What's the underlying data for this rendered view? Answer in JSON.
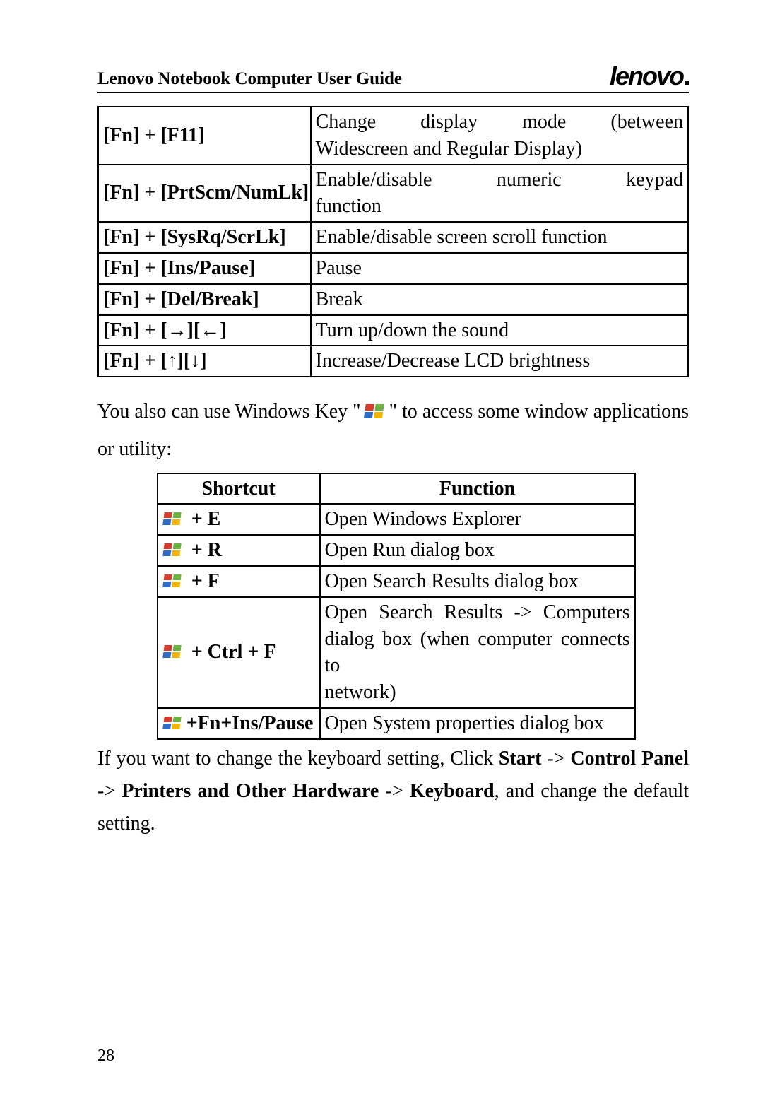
{
  "header": {
    "title": "Lenovo Notebook Computer User Guide",
    "logo": "lenovo"
  },
  "fn_table": {
    "rows": [
      {
        "key": "[Fn] + [F11]",
        "desc_line1": "Change display mode (between",
        "desc_line2": "Widescreen and Regular Display)",
        "justify": true
      },
      {
        "key": "[Fn] + [PrtScm/NumLk]",
        "desc_line1": "Enable/disable numeric keypad",
        "desc_line2": "function",
        "justify": true
      },
      {
        "key": "[Fn] + [SysRq/ScrLk]",
        "desc": "Enable/disable screen scroll function"
      },
      {
        "key": "[Fn] + [Ins/Pause]",
        "desc": "Pause"
      },
      {
        "key": "[Fn] + [Del/Break]",
        "desc": "Break"
      },
      {
        "key": "[Fn] + [→][←]",
        "desc": "Turn up/down the sound"
      },
      {
        "key": "[Fn] + [↑][↓]",
        "desc": "Increase/Decrease LCD brightness"
      }
    ]
  },
  "mid_text": {
    "part1": "You also can use Windows Key \"",
    "part2": "\" to access some window applications or utility:"
  },
  "win_table": {
    "headers": {
      "shortcut": "Shortcut",
      "function": "Function"
    },
    "rows": [
      {
        "suffix": " + E",
        "func": "Open Windows Explorer"
      },
      {
        "suffix": " + R",
        "func": "Open Run dialog box"
      },
      {
        "suffix": " + F",
        "func": "Open Search Results dialog box"
      },
      {
        "suffix": " + Ctrl + F",
        "func_line1": "Open Search Results -> Computers",
        "func_line2": "dialog box (when computer connects to",
        "func_line3": "network)",
        "justify": true
      },
      {
        "suffix": "+Fn+Ins/Pause",
        "func": "Open System properties dialog box"
      }
    ]
  },
  "bottom_text": {
    "seg1": "If you want to change the keyboard setting, Click ",
    "b1": "Start",
    "seg2": " -> ",
    "b2": "Control Panel",
    "seg3": " -> ",
    "b3": "Printers and Other Hardware",
    "seg4": " -> ",
    "b4": "Keyboard",
    "seg5": ", and change the default setting."
  },
  "page_number": "28"
}
